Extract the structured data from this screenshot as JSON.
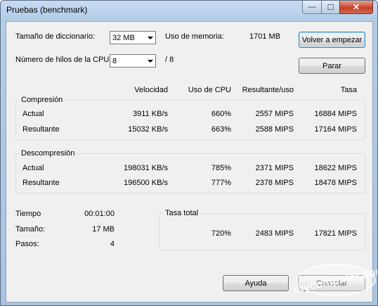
{
  "window": {
    "title": "Pruebas (benchmark)",
    "min_glyph": "—",
    "max_glyph": "☐",
    "close_glyph": "✕"
  },
  "settings": {
    "dictionary_label": "Tamaño de diccionario:",
    "dictionary_value": "32 MB",
    "threads_label": "Número de hilos de la CPU:",
    "threads_value": "8",
    "threads_total": "/ 8",
    "memory_label": "Uso de memoria:",
    "memory_value": "1701 MB"
  },
  "buttons": {
    "restart": "Volver a empezar",
    "stop": "Parar",
    "help": "Ayuda",
    "cancel": "Cancelar"
  },
  "columns": [
    "Velocidad",
    "Uso de CPU",
    "Resultante/uso",
    "Tasa"
  ],
  "compression": {
    "title": "Compresión",
    "rows": [
      {
        "label": "Actual",
        "speed": "3911 KB/s",
        "cpu": "660%",
        "ru": "2557 MIPS",
        "rate": "16884 MIPS"
      },
      {
        "label": "Resultante",
        "speed": "15032 KB/s",
        "cpu": "663%",
        "ru": "2588 MIPS",
        "rate": "17164 MIPS"
      }
    ]
  },
  "decompression": {
    "title": "Descompresión",
    "rows": [
      {
        "label": "Actual",
        "speed": "198031 KB/s",
        "cpu": "785%",
        "ru": "2371 MIPS",
        "rate": "18622 MIPS"
      },
      {
        "label": "Resultante",
        "speed": "196500 KB/s",
        "cpu": "777%",
        "ru": "2378 MIPS",
        "rate": "18478 MIPS"
      }
    ]
  },
  "stats": [
    {
      "label": "Tiempo",
      "value": "00:01:00"
    },
    {
      "label": "Tamaño:",
      "value": "17 MB"
    },
    {
      "label": "Pasos:",
      "value": "4"
    }
  ],
  "total": {
    "title": "Tasa total",
    "cpu": "720%",
    "ru": "2483 MIPS",
    "rate": "17821 MIPS"
  },
  "watermark": {
    "text": "muycomputer.com"
  }
}
